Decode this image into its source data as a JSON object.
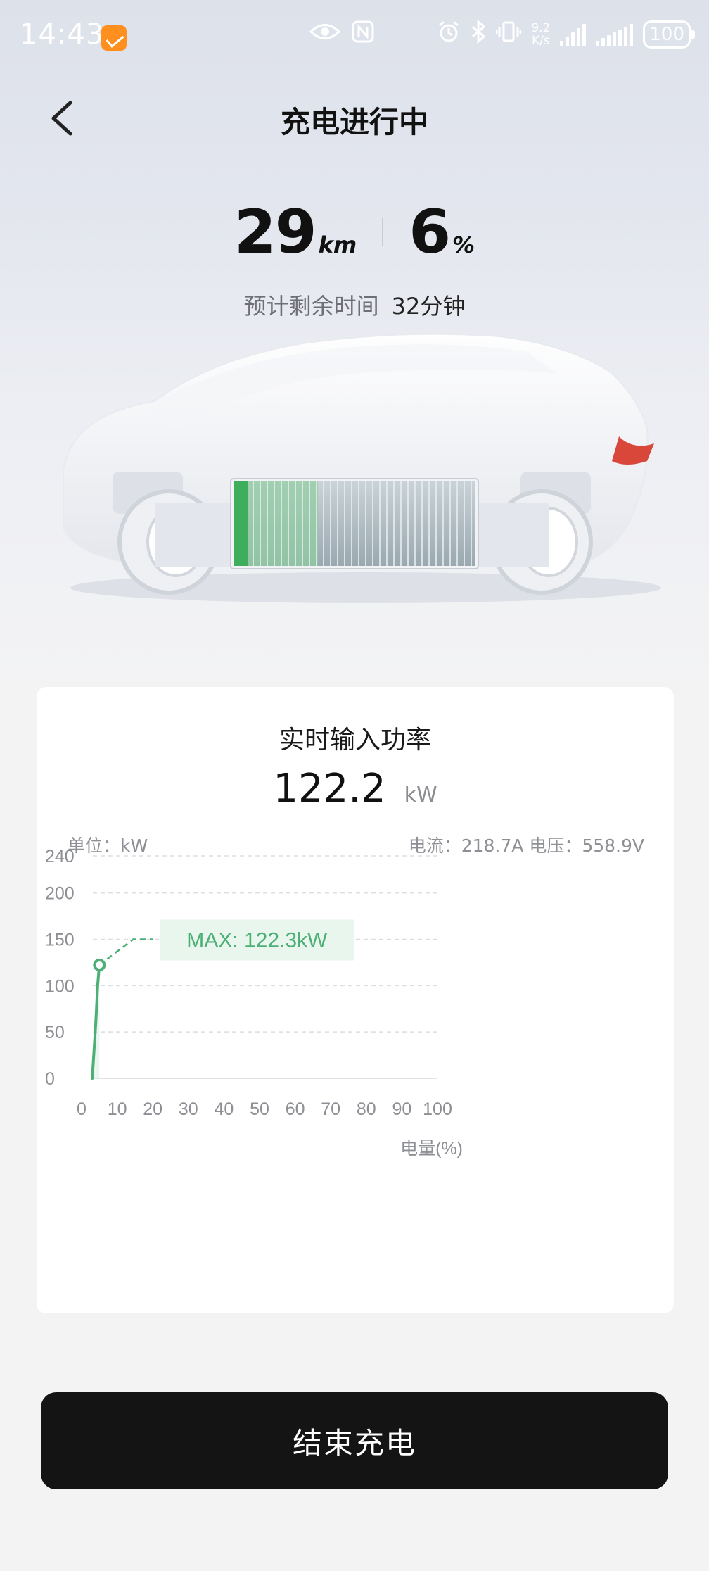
{
  "status_bar": {
    "time": "14:43",
    "net_speed_value": "9.2",
    "net_speed_unit": "K/s",
    "battery": "100",
    "icons": [
      "app-icon",
      "eye-icon",
      "nfc-icon",
      "alarm-icon",
      "bluetooth-icon",
      "vibrate-icon",
      "signal-icon",
      "signal-icon",
      "battery-icon"
    ]
  },
  "header": {
    "title": "充电进行中",
    "back_icon": "chevron-left-icon"
  },
  "stats": {
    "range_value": "29",
    "range_unit": "km",
    "soc_value": "6",
    "soc_unit": "%",
    "eta_label": "预计剩余时间",
    "eta_value": "32分钟"
  },
  "card": {
    "title": "实时输入功率",
    "power_value": "122.2",
    "power_unit": "kW",
    "unit_label": "单位：kW",
    "electric_label": "电流：218.7A   电压：558.9V"
  },
  "chart_data": {
    "type": "line",
    "xlabel": "电量(%)",
    "ylabel": "单位：kW",
    "xlim": [
      0,
      100
    ],
    "ylim": [
      0,
      240
    ],
    "x_ticks": [
      "0",
      "10",
      "20",
      "30",
      "40",
      "50",
      "60",
      "70",
      "80",
      "90",
      "100"
    ],
    "y_ticks": [
      "0",
      "50",
      "100",
      "150",
      "200",
      "240"
    ],
    "y_tick_values": [
      0,
      50,
      100,
      150,
      200,
      240
    ],
    "grid": true,
    "series": [
      {
        "color": "#4caf75",
        "x": [
          3,
          3.5,
          4,
          4.5,
          5
        ],
        "y": [
          0,
          30,
          60,
          100,
          122.3
        ]
      }
    ],
    "max_point": {
      "x": 5,
      "y": 122.3
    },
    "annotation": "MAX: 122.3kW"
  },
  "colors": {
    "accent_green": "#4caf75",
    "annotation_bg": "#e8f6ee",
    "button_bg": "#141414"
  },
  "end_button": {
    "label": "结束充电"
  }
}
